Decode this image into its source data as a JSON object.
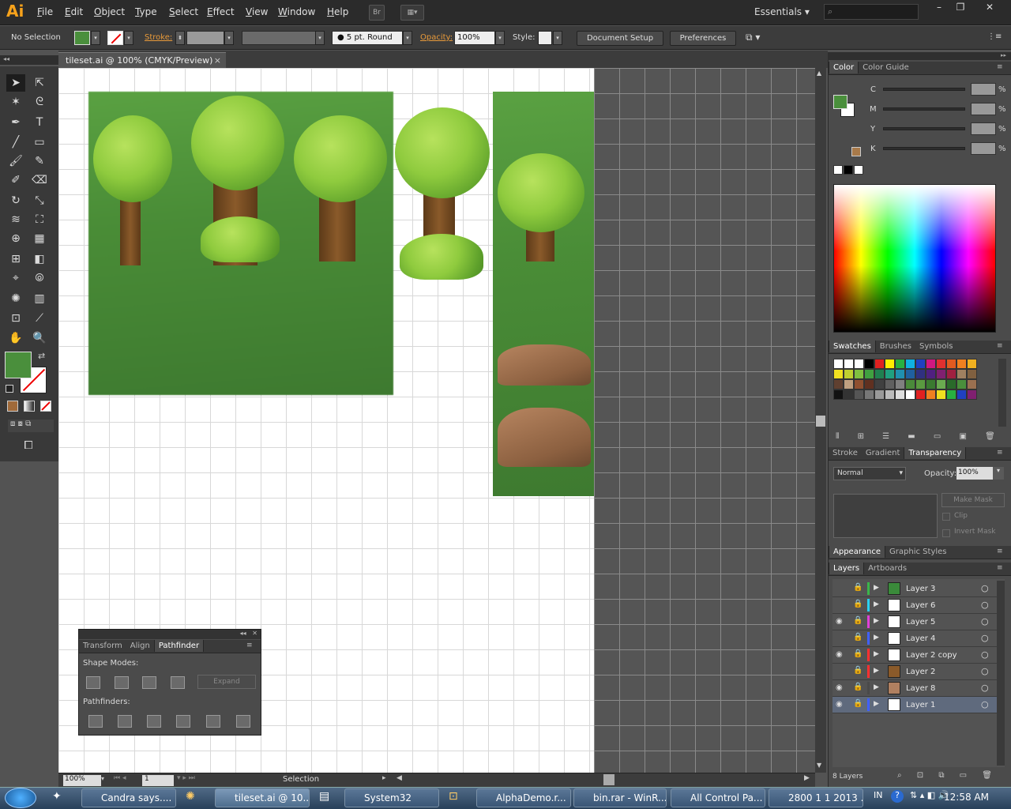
{
  "app": {
    "logo": "Ai"
  },
  "menu": [
    "File",
    "Edit",
    "Object",
    "Type",
    "Select",
    "Effect",
    "View",
    "Window",
    "Help"
  ],
  "bridge_label": "Br",
  "workspace": "Essentials",
  "control": {
    "selection": "No Selection",
    "stroke_label": "Stroke:",
    "brush": "5 pt. Round",
    "opacity_label": "Opacity:",
    "opacity": "100%",
    "style_label": "Style:",
    "doc_setup": "Document Setup",
    "preferences": "Preferences"
  },
  "document": {
    "tab_title": "tileset.ai @ 100% (CMYK/Preview)"
  },
  "status": {
    "zoom": "100%",
    "artboard": "1",
    "tool": "Selection"
  },
  "color_panel": {
    "tabs": [
      "Color",
      "Color Guide"
    ],
    "channels": [
      "C",
      "M",
      "Y",
      "K"
    ],
    "pct": "%"
  },
  "swatches_panel": {
    "tabs": [
      "Swatches",
      "Brushes",
      "Symbols"
    ]
  },
  "transparency_panel": {
    "tabs": [
      "Stroke",
      "Gradient",
      "Transparency"
    ],
    "blend": "Normal",
    "opacity_label": "Opacity:",
    "opacity": "100%",
    "make_mask": "Make Mask",
    "clip": "Clip",
    "invert": "Invert Mask"
  },
  "appearance_panel": {
    "tabs": [
      "Appearance",
      "Graphic Styles"
    ]
  },
  "layers_panel": {
    "tabs": [
      "Layers",
      "Artboards"
    ],
    "count": "8 Layers",
    "layers": [
      {
        "name": "Layer 3",
        "color": "#3ab54a",
        "visible": false
      },
      {
        "name": "Layer 6",
        "color": "#29d0f0",
        "visible": false
      },
      {
        "name": "Layer 5",
        "color": "#e040d8",
        "visible": true
      },
      {
        "name": "Layer 4",
        "color": "#4060ff",
        "visible": false
      },
      {
        "name": "Layer 2 copy",
        "color": "#ff3030",
        "visible": true
      },
      {
        "name": "Layer 2",
        "color": "#ff3030",
        "visible": false
      },
      {
        "name": "Layer 8",
        "color": "#4a4a4a",
        "visible": true
      },
      {
        "name": "Layer 1",
        "color": "#4060ff",
        "visible": true
      }
    ]
  },
  "pathfinder": {
    "tabs": [
      "Transform",
      "Align",
      "Pathfinder"
    ],
    "shape_modes": "Shape Modes:",
    "expand": "Expand",
    "pathfinders": "Pathfinders:"
  },
  "taskbar": {
    "items": [
      "Candra says.... ...",
      "tileset.ai @ 10...",
      "System32",
      "AlphaDemo.r...",
      "bin.rar - WinR...",
      "All Control Pa...",
      "2800 1 1 2013 ..."
    ],
    "lang": "IN",
    "clock": "12:58 AM"
  }
}
